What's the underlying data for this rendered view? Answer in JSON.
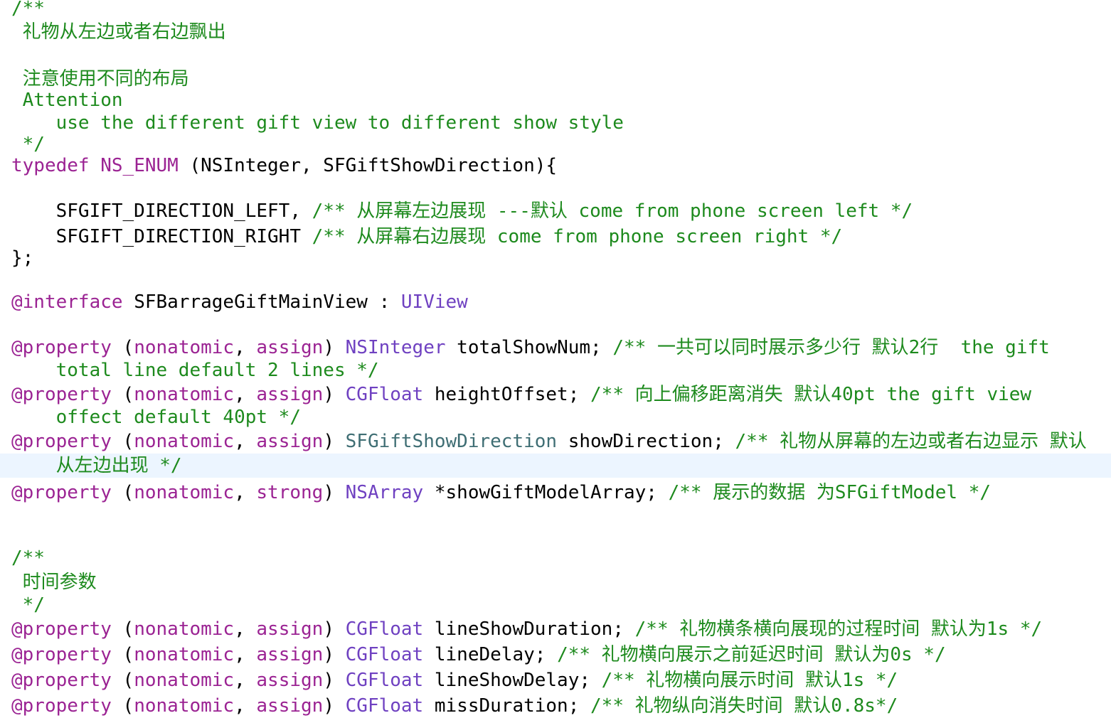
{
  "editor": {
    "current_line_highlight": "#ecf5ff",
    "colors": {
      "comment": "#1d8a1d",
      "keyword": "#9b2393",
      "type": "#6f41c1",
      "enum_type": "#3f6e74",
      "plain": "#000000"
    },
    "lines": [
      {
        "segments": [
          {
            "cls": "comment",
            "text": "/**"
          }
        ]
      },
      {
        "segments": [
          {
            "cls": "comment",
            "text": " 礼物从左边或者右边飘出"
          }
        ]
      },
      {
        "segments": [
          {
            "cls": "comment",
            "text": " 注意使用不同的布局"
          }
        ]
      },
      {
        "segments": [
          {
            "cls": "comment",
            "text": " Attention"
          }
        ]
      },
      {
        "segments": [
          {
            "cls": "comment",
            "text": "    use the different gift view to different show style"
          }
        ]
      },
      {
        "segments": [
          {
            "cls": "comment",
            "text": " */"
          }
        ]
      },
      {
        "segments": [
          {
            "cls": "kw",
            "text": "typedef"
          },
          {
            "cls": "plain",
            "text": " "
          },
          {
            "cls": "kw",
            "text": "NS_ENUM"
          },
          {
            "cls": "plain",
            "text": " (NSInteger, SFGiftShowDirection){"
          }
        ]
      },
      {
        "segments": [
          {
            "cls": "plain",
            "text": "    SFGIFT_DIRECTION_LEFT, "
          },
          {
            "cls": "comment",
            "text": "/** 从屏幕左边展现 ---默认 come from phone screen left */"
          }
        ]
      },
      {
        "segments": [
          {
            "cls": "plain",
            "text": "    SFGIFT_DIRECTION_RIGHT "
          },
          {
            "cls": "comment",
            "text": "/** 从屏幕右边展现 come from phone screen right */"
          }
        ]
      },
      {
        "segments": [
          {
            "cls": "plain",
            "text": "};"
          }
        ]
      },
      {
        "segments": [
          {
            "cls": "kw",
            "text": "@interface"
          },
          {
            "cls": "plain",
            "text": " SFBarrageGiftMainView : "
          },
          {
            "cls": "type",
            "text": "UIView"
          }
        ]
      },
      {
        "segments": [
          {
            "cls": "kw",
            "text": "@property"
          },
          {
            "cls": "plain",
            "text": " ("
          },
          {
            "cls": "kw",
            "text": "nonatomic"
          },
          {
            "cls": "plain",
            "text": ", "
          },
          {
            "cls": "kw",
            "text": "assign"
          },
          {
            "cls": "plain",
            "text": ") "
          },
          {
            "cls": "type",
            "text": "NSInteger"
          },
          {
            "cls": "plain",
            "text": " totalShowNum; "
          },
          {
            "cls": "comment",
            "text": "/** 一共可以同时展示多少行 默认2行  the gift"
          }
        ]
      },
      {
        "segments": [
          {
            "cls": "comment",
            "text": "    total line default 2 lines */"
          }
        ]
      },
      {
        "segments": [
          {
            "cls": "kw",
            "text": "@property"
          },
          {
            "cls": "plain",
            "text": " ("
          },
          {
            "cls": "kw",
            "text": "nonatomic"
          },
          {
            "cls": "plain",
            "text": ", "
          },
          {
            "cls": "kw",
            "text": "assign"
          },
          {
            "cls": "plain",
            "text": ") "
          },
          {
            "cls": "type",
            "text": "CGFloat"
          },
          {
            "cls": "plain",
            "text": " heightOffset; "
          },
          {
            "cls": "comment",
            "text": "/** 向上偏移距离消失 默认40pt the gift view"
          }
        ]
      },
      {
        "segments": [
          {
            "cls": "comment",
            "text": "    offect default 40pt */"
          }
        ]
      },
      {
        "segments": [
          {
            "cls": "kw",
            "text": "@property"
          },
          {
            "cls": "plain",
            "text": " ("
          },
          {
            "cls": "kw",
            "text": "nonatomic"
          },
          {
            "cls": "plain",
            "text": ", "
          },
          {
            "cls": "kw",
            "text": "assign"
          },
          {
            "cls": "plain",
            "text": ") "
          },
          {
            "cls": "enum-type",
            "text": "SFGiftShowDirection"
          },
          {
            "cls": "plain",
            "text": " showDirection; "
          },
          {
            "cls": "comment",
            "text": "/** 礼物从屏幕的左边或者右边显示 默认"
          }
        ]
      },
      {
        "current": true,
        "segments": [
          {
            "cls": "comment",
            "text": "    从左边出现 */"
          }
        ]
      },
      {
        "segments": [
          {
            "cls": "kw",
            "text": "@property"
          },
          {
            "cls": "plain",
            "text": " ("
          },
          {
            "cls": "kw",
            "text": "nonatomic"
          },
          {
            "cls": "plain",
            "text": ", "
          },
          {
            "cls": "kw",
            "text": "strong"
          },
          {
            "cls": "plain",
            "text": ") "
          },
          {
            "cls": "type",
            "text": "NSArray"
          },
          {
            "cls": "plain",
            "text": " *showGiftModelArray; "
          },
          {
            "cls": "comment",
            "text": "/** 展示的数据 为SFGiftModel */"
          }
        ]
      },
      {
        "segments": [
          {
            "cls": "comment",
            "text": "/**"
          }
        ]
      },
      {
        "segments": [
          {
            "cls": "comment",
            "text": " 时间参数"
          }
        ]
      },
      {
        "segments": [
          {
            "cls": "comment",
            "text": " */"
          }
        ]
      },
      {
        "segments": [
          {
            "cls": "kw",
            "text": "@property"
          },
          {
            "cls": "plain",
            "text": " ("
          },
          {
            "cls": "kw",
            "text": "nonatomic"
          },
          {
            "cls": "plain",
            "text": ", "
          },
          {
            "cls": "kw",
            "text": "assign"
          },
          {
            "cls": "plain",
            "text": ") "
          },
          {
            "cls": "type",
            "text": "CGFloat"
          },
          {
            "cls": "plain",
            "text": " lineShowDuration; "
          },
          {
            "cls": "comment",
            "text": "/** 礼物横条横向展现的过程时间 默认为1s */"
          }
        ]
      },
      {
        "segments": [
          {
            "cls": "kw",
            "text": "@property"
          },
          {
            "cls": "plain",
            "text": " ("
          },
          {
            "cls": "kw",
            "text": "nonatomic"
          },
          {
            "cls": "plain",
            "text": ", "
          },
          {
            "cls": "kw",
            "text": "assign"
          },
          {
            "cls": "plain",
            "text": ") "
          },
          {
            "cls": "type",
            "text": "CGFloat"
          },
          {
            "cls": "plain",
            "text": " lineDelay; "
          },
          {
            "cls": "comment",
            "text": "/** 礼物横向展示之前延迟时间 默认为0s */"
          }
        ]
      },
      {
        "segments": [
          {
            "cls": "kw",
            "text": "@property"
          },
          {
            "cls": "plain",
            "text": " ("
          },
          {
            "cls": "kw",
            "text": "nonatomic"
          },
          {
            "cls": "plain",
            "text": ", "
          },
          {
            "cls": "kw",
            "text": "assign"
          },
          {
            "cls": "plain",
            "text": ") "
          },
          {
            "cls": "type",
            "text": "CGFloat"
          },
          {
            "cls": "plain",
            "text": " lineShowDelay; "
          },
          {
            "cls": "comment",
            "text": "/** 礼物横向展示时间 默认1s */"
          }
        ]
      },
      {
        "segments": [
          {
            "cls": "kw",
            "text": "@property"
          },
          {
            "cls": "plain",
            "text": " ("
          },
          {
            "cls": "kw",
            "text": "nonatomic"
          },
          {
            "cls": "plain",
            "text": ", "
          },
          {
            "cls": "kw",
            "text": "assign"
          },
          {
            "cls": "plain",
            "text": ") "
          },
          {
            "cls": "type",
            "text": "CGFloat"
          },
          {
            "cls": "plain",
            "text": " missDuration; "
          },
          {
            "cls": "comment",
            "text": "/** 礼物纵向消失时间 默认0.8s*/"
          }
        ]
      }
    ]
  }
}
